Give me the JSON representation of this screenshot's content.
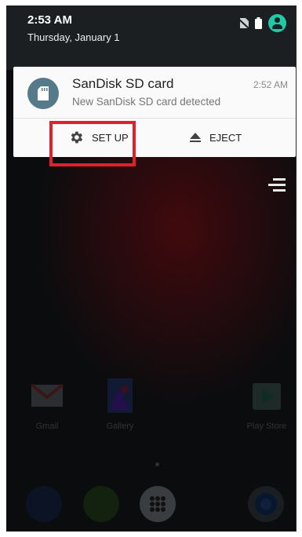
{
  "status_bar": {
    "time": "2:53 AM",
    "date": "Thursday, January 1"
  },
  "notification": {
    "title": "SanDisk SD card",
    "text": "New SanDisk SD card detected",
    "time": "2:52 AM",
    "actions": {
      "setup_label": "SET UP",
      "eject_label": "EJECT"
    }
  },
  "home_apps": [
    {
      "label": "Gmail"
    },
    {
      "label": "Gallery"
    },
    {
      "label": "Play Store"
    }
  ],
  "colors": {
    "highlight": "#e3202a",
    "avatar": "#22c9a6",
    "notification_icon_bg": "#557a8a"
  }
}
